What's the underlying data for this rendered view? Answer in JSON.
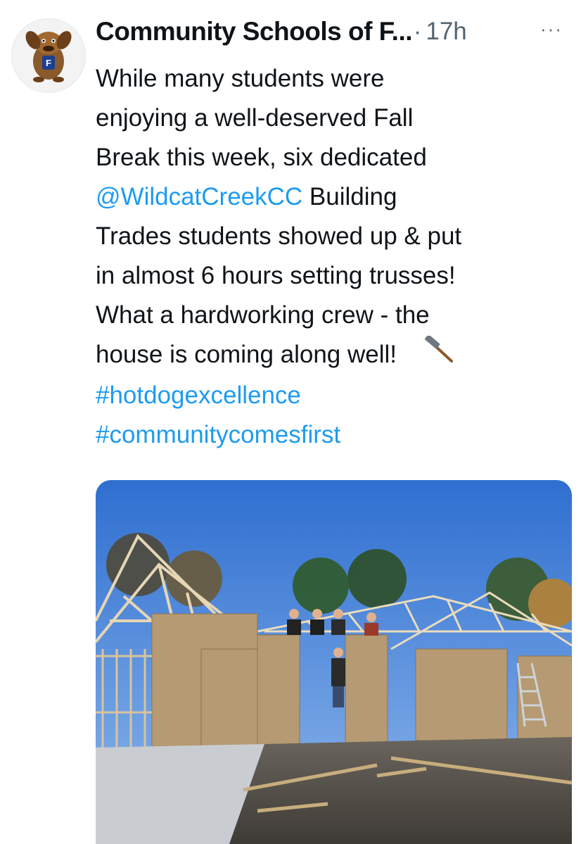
{
  "author": {
    "display_name": "Community Schools of F...",
    "separator": "·",
    "timestamp": "17h",
    "avatar_icon": "hotdog-dog-mascot-icon"
  },
  "more_menu": {
    "label": "···",
    "icon": "more-options-icon"
  },
  "tweet": {
    "lines": [
      "While many students were",
      "enjoying a well-deserved Fall",
      "Break this week, six dedicated"
    ],
    "mention": "@WildcatCreekCC",
    "line4_rest": " Building",
    "line5": "Trades students showed up & put",
    "line6": "in almost 6 hours setting trusses!",
    "line7": "What a hardworking crew - the",
    "line8": "house is coming along well!",
    "emoji_icon": "hammer-icon",
    "hashtags": [
      "#hotdogexcellence",
      "#communitycomesfirst"
    ]
  },
  "colors": {
    "text": "#0f1419",
    "secondary": "#536471",
    "link": "#1d9bf0"
  },
  "media": {
    "description_icon": "construction-photo"
  }
}
